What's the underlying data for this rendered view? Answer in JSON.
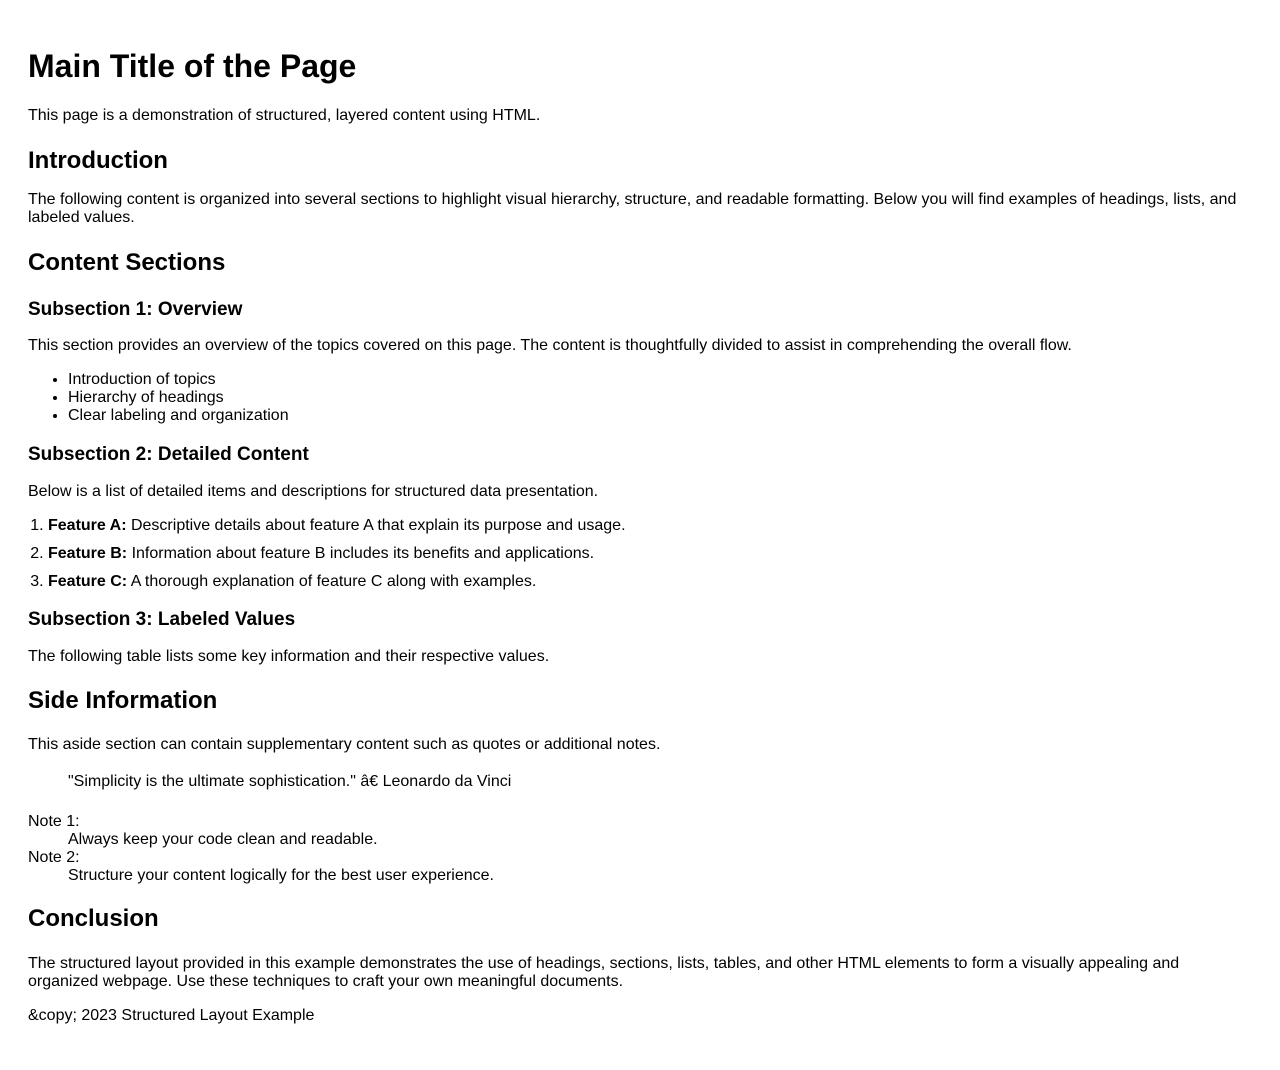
{
  "header": {
    "title": "Main Title of the Page",
    "subtitle": "This page is a demonstration of structured, layered content using HTML."
  },
  "intro": {
    "heading": "Introduction",
    "body": "The following content is organized into several sections to highlight visual hierarchy, structure, and readable formatting. Below you will find examples of headings, lists, and labeled values."
  },
  "content": {
    "heading": "Content Sections",
    "sub1": {
      "heading": "Subsection 1: Overview",
      "body": "This section provides an overview of the topics covered on this page. The content is thoughtfully divided to assist in comprehending the overall flow.",
      "items": [
        "Introduction of topics",
        "Hierarchy of headings",
        "Clear labeling and organization"
      ]
    },
    "sub2": {
      "heading": "Subsection 2: Detailed Content",
      "body": "Below is a list of detailed items and descriptions for structured data presentation.",
      "features": [
        {
          "label": "Feature A:",
          "text": " Descriptive details about feature A that explain its purpose and usage."
        },
        {
          "label": "Feature B:",
          "text": " Information about feature B includes its benefits and applications."
        },
        {
          "label": "Feature C:",
          "text": " A thorough explanation of feature C along with examples."
        }
      ]
    },
    "sub3": {
      "heading": "Subsection 3: Labeled Values",
      "body": "The following table lists some key information and their respective values."
    }
  },
  "side": {
    "heading": "Side Information",
    "body": "This aside section can contain supplementary content such as quotes or additional notes.",
    "quote": "\"Simplicity is the ultimate sophistication.\" â€ Leonardo da Vinci",
    "notes": [
      {
        "term": "Note 1:",
        "desc": "Always keep your code clean and readable."
      },
      {
        "term": "Note 2:",
        "desc": "Structure your content logically for the best user experience."
      }
    ]
  },
  "conclusion": {
    "heading": "Conclusion",
    "body": "The structured layout provided in this example demonstrates the use of headings, sections, lists, tables, and other HTML elements to form a visually appealing and organized webpage. Use these techniques to craft your own meaningful documents."
  },
  "footer": {
    "text": "&copy; 2023 Structured Layout Example"
  }
}
